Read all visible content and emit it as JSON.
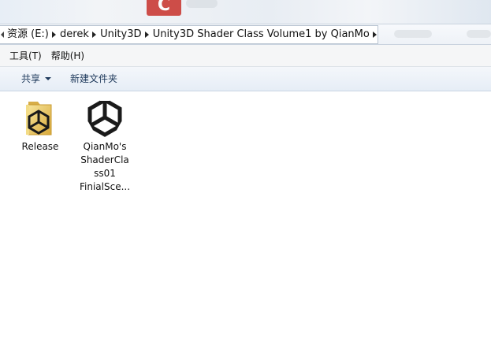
{
  "titlebar": {
    "icons": [
      "app-logo-icon"
    ]
  },
  "address_bar": {
    "crumbs": [
      {
        "label": "资源 (E:)"
      },
      {
        "label": "derek"
      },
      {
        "label": "Unity3D"
      },
      {
        "label": "Unity3D Shader Class Volume1 by QianMo"
      }
    ]
  },
  "menu": {
    "items": [
      {
        "label": "工具(T)"
      },
      {
        "label": "帮助(H)"
      }
    ]
  },
  "toolbar": {
    "share_label": "共享",
    "new_folder_label": "新建文件夹"
  },
  "files": [
    {
      "name": "Release",
      "icon": "folder-unity-icon"
    },
    {
      "name_lines": [
        "QianMo's",
        "ShaderCla",
        "ss01",
        "FinialSce..."
      ],
      "icon": "unity-icon"
    }
  ],
  "colors": {
    "toolbar_text": "#1e395b",
    "folder_yellow": "#e8c55a",
    "unity_black": "#1a1a1a",
    "logo_red": "#c8312b"
  }
}
